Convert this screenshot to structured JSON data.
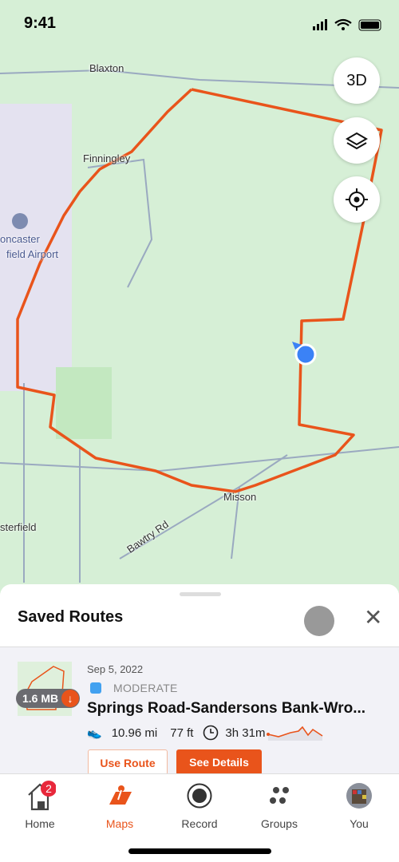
{
  "status": {
    "time": "9:41"
  },
  "map": {
    "labels": {
      "blaxton": "Blaxton",
      "finningley": "Finningley",
      "airport_line1": "oncaster",
      "airport_line2": "field Airport",
      "misson": "Misson",
      "bawtry": "Bawtry Rd",
      "sterfield": "sterfield"
    },
    "buttons": {
      "three_d": "3D",
      "layers_icon": "layers-icon",
      "locate_icon": "locate-icon"
    },
    "route_color": "#e9541b",
    "location_color": "#3b82f6"
  },
  "sheet": {
    "title": "Saved Routes"
  },
  "route": {
    "date": "Sep 5, 2022",
    "difficulty": "MODERATE",
    "difficulty_color": "#42a1f0",
    "name": "Springs Road-Sandersons Bank-Wro...",
    "size": "1.6 MB",
    "distance": "10.96 mi",
    "elevation": "77 ft",
    "duration": "3h 31m",
    "use_label": "Use Route",
    "details_label": "See Details"
  },
  "tabs": [
    {
      "label": "Home",
      "badge": "2"
    },
    {
      "label": "Maps",
      "active": true
    },
    {
      "label": "Record"
    },
    {
      "label": "Groups"
    },
    {
      "label": "You"
    }
  ],
  "accent": "#e9541b"
}
